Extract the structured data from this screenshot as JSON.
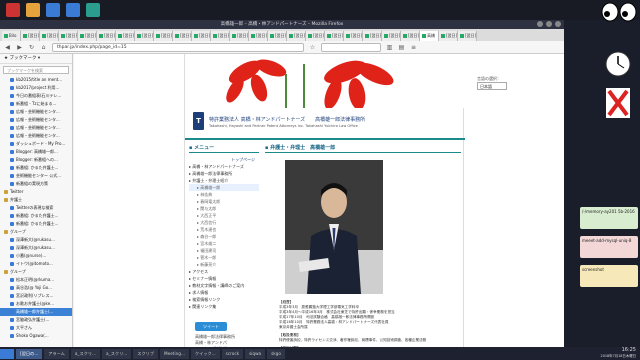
{
  "browser": {
    "title": "高橋雄一郎 – 高橋・林アンドパートナーズ – Mozilla Firefox",
    "tabs": [
      "Bilo",
      "[翌日]",
      "[翌日]",
      "[翌日]",
      "[翌日]",
      "[翌日]",
      "[翌日]",
      "[翌日]",
      "[翌日]",
      "[翌日]",
      "[翌日]",
      "[翌日]",
      "[翌日]",
      "[翌日]",
      "[翌日]",
      "[翌日]",
      "[翌日]",
      "[翌日]",
      "[翌日]",
      "[翌日]",
      "[翌日]",
      "[翌日]",
      "高橋",
      "[翌日]",
      "[翌日]"
    ],
    "url": "thpar.jp/index.php/page_id=15"
  },
  "sidebar": {
    "header": "ブックマーク",
    "search_placeholder": "ブックマークを検索",
    "items": [
      {
        "label": "kb2015/title an ment...",
        "type": "link"
      },
      {
        "label": "kb2017/project 利用...",
        "type": "link"
      },
      {
        "label": "今日の番組表(石川テレ...",
        "type": "link"
      },
      {
        "label": "新番組 - Tzに始まる...",
        "type": "link"
      },
      {
        "label": "広報・芸術機能センタ...",
        "type": "link"
      },
      {
        "label": "広報・芸術機能センタ...",
        "type": "link"
      },
      {
        "label": "広報・芸術機能センタ...",
        "type": "link"
      },
      {
        "label": "広報・芸術機能センタ...",
        "type": "link"
      },
      {
        "label": "ダッシュボード - My Pro...",
        "type": "link"
      },
      {
        "label": "Blogger: 高橋雄一郎...",
        "type": "link"
      },
      {
        "label": "Blogger: 新番組への...",
        "type": "link"
      },
      {
        "label": "新番組: かるた弁護士...",
        "type": "link"
      },
      {
        "label": "芸術機能センター 公式...",
        "type": "link"
      },
      {
        "label": "新番組の実現方策",
        "type": "link"
      },
      {
        "label": "Twitter",
        "type": "folder"
      },
      {
        "label": "弁護士",
        "type": "folder"
      },
      {
        "label": "Twitterの表現な検索",
        "type": "link"
      },
      {
        "label": "新番組: かるた弁護士...",
        "type": "link"
      },
      {
        "label": "新番組: かるた弁護士...",
        "type": "link"
      },
      {
        "label": "グループ",
        "type": "folder"
      },
      {
        "label": "深澤新大(@rukasu...",
        "type": "link"
      },
      {
        "label": "深澤新大(@rukasu...",
        "type": "link"
      },
      {
        "label": "小番(@nurse)...",
        "type": "link"
      },
      {
        "label": "イトウ(@itomoto...",
        "type": "link"
      },
      {
        "label": "グループ",
        "type": "folder"
      },
      {
        "label": "松本正明(@rkuma...",
        "type": "link"
      },
      {
        "label": "高谷浩(@ Yoji Go...",
        "type": "link"
      },
      {
        "label": "宮沢政利(リプレス...",
        "type": "link"
      },
      {
        "label": "お歌お弁護士(@ke...",
        "type": "link"
      },
      {
        "label": "高橋雄一郎弁護士(...",
        "type": "link",
        "selected": true
      },
      {
        "label": "宮脇政弘弁護士(...",
        "type": "link"
      },
      {
        "label": "大平さん",
        "type": "link"
      },
      {
        "label": "Shoko Ogawa(...",
        "type": "link"
      }
    ]
  },
  "site": {
    "firm_name": "特許業務法人 高橋・林アンドパートナーズ　　高橋雄一郎法律事務所",
    "firm_name_en": "Takahashi, Hayashi and Partner Patent Attorneys Inc.   Takahashi Yuichiro Law Office",
    "language_label": "言語の選択：",
    "language_value": "日本語",
    "small_links": "お問い合わせ | サイトマ",
    "menu_title": "メニュー",
    "menu": [
      {
        "label": "トップページ",
        "kind": "top"
      },
      {
        "label": "高橋・林アンドパートナーズ",
        "kind": "main"
      },
      {
        "label": "高橋雄一郎法律事務所",
        "kind": "main"
      },
      {
        "label": "弁護士・弁理士紹介",
        "kind": "main"
      },
      {
        "label": "高橋雄一郎",
        "kind": "sub",
        "selected": true
      },
      {
        "label": "林佳典",
        "kind": "sub"
      },
      {
        "label": "春岡竜太郎",
        "kind": "sub"
      },
      {
        "label": "関与太郎",
        "kind": "sub"
      },
      {
        "label": "大西正平",
        "kind": "sub"
      },
      {
        "label": "大西信行",
        "kind": "sub"
      },
      {
        "label": "荒木達也",
        "kind": "sub"
      },
      {
        "label": "森谷一郎",
        "kind": "sub"
      },
      {
        "label": "宮木雄二",
        "kind": "sub"
      },
      {
        "label": "福田建司",
        "kind": "sub"
      },
      {
        "label": "菅木一郎",
        "kind": "sub"
      },
      {
        "label": "新藤亮介",
        "kind": "sub"
      },
      {
        "label": "アクセス",
        "kind": "main"
      },
      {
        "label": "セミナー情報",
        "kind": "main"
      },
      {
        "label": "教材文字情報・講師のご案内",
        "kind": "main"
      },
      {
        "label": "求人情報",
        "kind": "main"
      },
      {
        "label": "検索情報リンク",
        "kind": "main"
      },
      {
        "label": "関連リンク集",
        "kind": "main"
      }
    ],
    "twitter_label": "ツイート",
    "footer_address": [
      "高橋雄一郎法律事務所",
      "高橋・林アンドパ",
      "ートナーズ法務部"
    ],
    "page_title": "弁護士・弁理士　高橋雄一郎",
    "bio": [
      {
        "text": "【経歴】",
        "head": true
      },
      {
        "text": "平成3年3月　慶應義塾大学理工学部電気工学科卒"
      },
      {
        "text": "平成3年4月〜平成16年3月　株式会社東芝で特許出願・係争業務を担当"
      },
      {
        "text": "平成17年10月　司法試験合格　高橋雄一郎法律事務所開設"
      },
      {
        "text": "平成18年10月　特許業務法人高橋・林アンドパートナーズ代表社員"
      },
      {
        "text": "東京弁護士会所属"
      },
      {
        "text": "",
        "head": false
      },
      {
        "text": "【取扱業務】",
        "head": true
      },
      {
        "text": "特許侵害訴訟、特許ライセンス交渉、著作権訴訟、商標事件、公知技術調査、各種企業法務"
      },
      {
        "text": "",
        "head": false
      },
      {
        "text": "【技術分野】",
        "head": true
      },
      {
        "text": "電子回路、半導体、画像、材料工学、ハイテクノロジー、ソフトウェア、医薬品、機械構造"
      }
    ]
  },
  "desktop_notes": [
    {
      "label": "/-/memory-ay201 5b-2016"
    },
    {
      "label": "meeet-add-mysql-uniq-8"
    },
    {
      "label": "screenshot"
    }
  ],
  "taskbar": {
    "items": [
      "",
      "[翌日の...",
      "アラーム",
      "a_スクリ...",
      "a_スクリ...",
      "スクリブ",
      "Meeting...",
      "クイック...",
      "scrock",
      "siqwa",
      "skgo"
    ],
    "active_index": 0,
    "time": "16:25",
    "date": "2018年7月18日木曜日",
    "ime": "jp"
  },
  "colors": {
    "accent": "#1a8a8a",
    "firm_blue": "#1c3f7a",
    "selected": "#3b82d6"
  }
}
